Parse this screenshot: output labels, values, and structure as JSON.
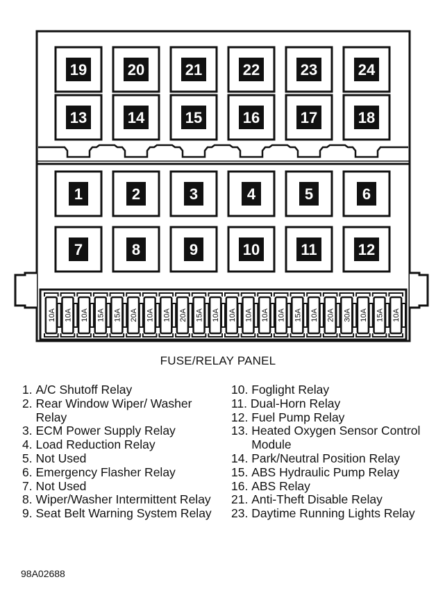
{
  "diagram": {
    "title": "FUSE/RELAY PANEL",
    "figure_id": "98A02688",
    "relay_rows": [
      [
        "19",
        "20",
        "21",
        "22",
        "23",
        "24"
      ],
      [
        "13",
        "14",
        "15",
        "16",
        "17",
        "18"
      ],
      [
        "1",
        "2",
        "3",
        "4",
        "5",
        "6"
      ],
      [
        "7",
        "8",
        "9",
        "10",
        "11",
        "12"
      ]
    ],
    "fuses": [
      "10A",
      "10A",
      "10A",
      "15A",
      "15A",
      "20A",
      "10A",
      "10A",
      "20A",
      "15A",
      "10A",
      "10A",
      "10A",
      "10A",
      "10A",
      "15A",
      "10A",
      "20A",
      "30A",
      "10A",
      "15A",
      "10A"
    ]
  },
  "legend": {
    "left": [
      {
        "num": "1.",
        "text": "A/C Shutoff Relay"
      },
      {
        "num": "2.",
        "text": "Rear Window Wiper/ Washer Relay"
      },
      {
        "num": "3.",
        "text": "ECM Power Supply Relay"
      },
      {
        "num": "4.",
        "text": "Load Reduction Relay"
      },
      {
        "num": "5.",
        "text": "Not Used"
      },
      {
        "num": "6.",
        "text": "Emergency Flasher Relay"
      },
      {
        "num": "7.",
        "text": "Not Used"
      },
      {
        "num": "8.",
        "text": "Wiper/Washer Intermittent Relay"
      },
      {
        "num": "9.",
        "text": "Seat Belt Warning System Relay"
      }
    ],
    "right": [
      {
        "num": "10.",
        "text": "Foglight Relay"
      },
      {
        "num": "11.",
        "text": "Dual-Horn Relay"
      },
      {
        "num": "12.",
        "text": "Fuel Pump Relay"
      },
      {
        "num": "13.",
        "text": "Heated Oxygen Sensor Control Module"
      },
      {
        "num": "14.",
        "text": "Park/Neutral Position Relay"
      },
      {
        "num": "15.",
        "text": "ABS Hydraulic Pump Relay"
      },
      {
        "num": "16.",
        "text": "ABS Relay"
      },
      {
        "num": "21.",
        "text": "Anti-Theft Disable Relay"
      },
      {
        "num": "23.",
        "text": "Daytime Running Lights Relay"
      }
    ]
  }
}
